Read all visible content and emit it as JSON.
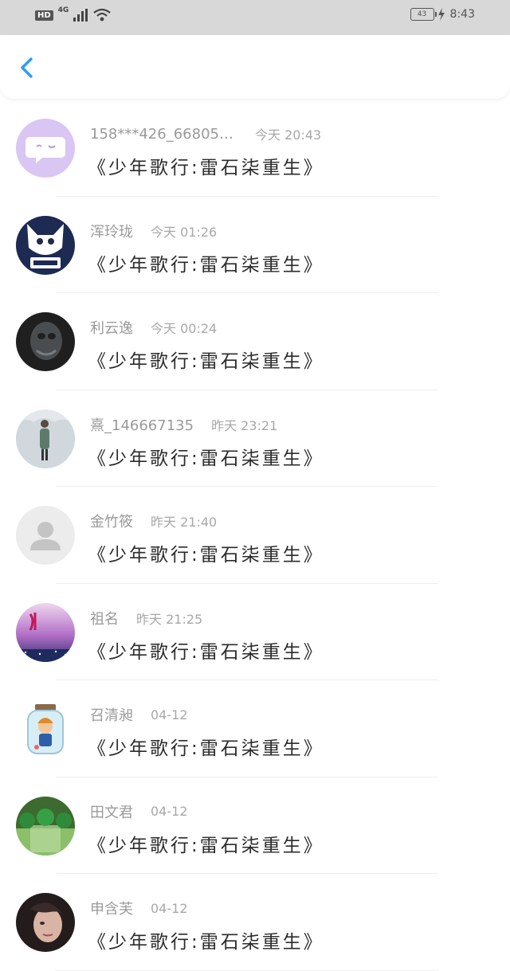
{
  "status_bar": {
    "hd": "HD",
    "network": "4G",
    "battery": "43",
    "time": "8:43"
  },
  "nav": {
    "back_icon": "chevron-left-icon",
    "accent_color": "#2b9cf5"
  },
  "messages": [
    {
      "name": "158***426_668059…",
      "time": "今天 20:43",
      "text": "《少年歌行:雷石柒重生》",
      "avatar": "chat-bubble"
    },
    {
      "name": "浑玲珑",
      "time": "今天 01:26",
      "text": "《少年歌行:雷石柒重生》",
      "avatar": "cat-deep"
    },
    {
      "name": "利云逸",
      "time": "今天 00:24",
      "text": "《少年歌行:雷石柒重生》",
      "avatar": "dark-photo"
    },
    {
      "name": "熹_146667135",
      "time": "昨天 23:21",
      "text": "《少年歌行:雷石柒重生》",
      "avatar": "snow-photo"
    },
    {
      "name": "金竹筱",
      "time": "昨天 21:40",
      "text": "《少年歌行:雷石柒重生》",
      "avatar": "default-user"
    },
    {
      "name": "祖名",
      "time": "昨天 21:25",
      "text": "《少年歌行:雷石柒重生》",
      "avatar": "purple-night"
    },
    {
      "name": "召清昶",
      "time": "04-12",
      "text": "《少年歌行:雷石柒重生》",
      "avatar": "jar-character"
    },
    {
      "name": "田文君",
      "time": "04-12",
      "text": "《少年歌行:雷石柒重生》",
      "avatar": "green-plant"
    },
    {
      "name": "申含芙",
      "time": "04-12",
      "text": "《少年歌行:雷石柒重生》",
      "avatar": "dark-portrait"
    }
  ]
}
